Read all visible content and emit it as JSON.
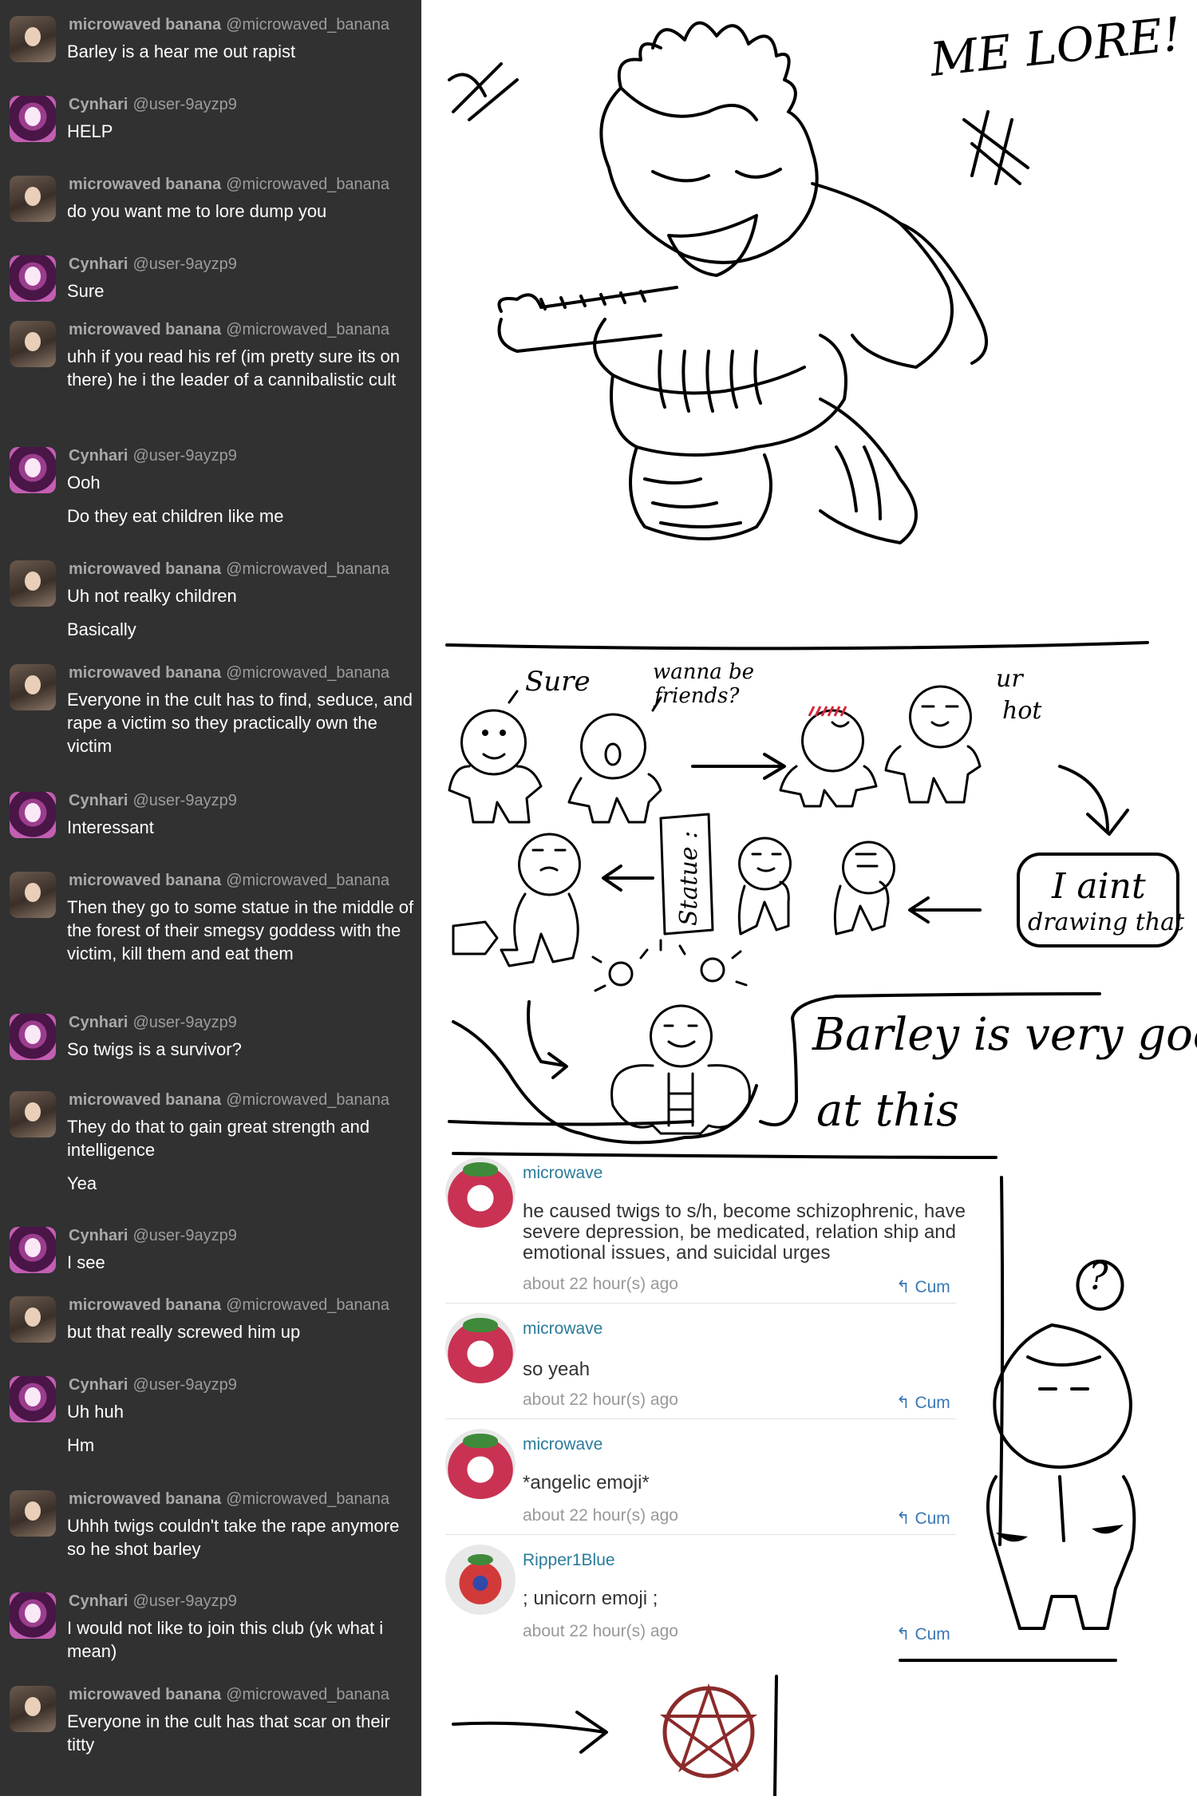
{
  "chat": {
    "messages": [
      {
        "user": "microwaved banana",
        "handle": "@microwaved_banana",
        "lines": [
          "Barley is a hear me out rapist"
        ]
      },
      {
        "user": "Cynhari",
        "handle": "@user-9ayzp9",
        "lines": [
          "HELP"
        ]
      },
      {
        "user": "microwaved banana",
        "handle": "@microwaved_banana",
        "lines": [
          "do you want me to lore dump you"
        ]
      },
      {
        "user": "Cynhari",
        "handle": "@user-9ayzp9",
        "lines": [
          "Sure"
        ]
      },
      {
        "user": "microwaved banana",
        "handle": "@microwaved_banana",
        "lines": [
          "uhh if you read his ref (im pretty sure its on there) he i the leader of a cannibalistic cult"
        ]
      },
      {
        "user": "Cynhari",
        "handle": "@user-9ayzp9",
        "lines": [
          "Ooh",
          "Do they eat children like me"
        ]
      },
      {
        "user": "microwaved banana",
        "handle": "@microwaved_banana",
        "lines": [
          "Uh not realky children",
          "Basically"
        ]
      },
      {
        "user": "microwaved banana",
        "handle": "@microwaved_banana",
        "lines": [
          "Everyone in the cult has to find, seduce, and rape a victim so they practically own the victim"
        ]
      },
      {
        "user": "Cynhari",
        "handle": "@user-9ayzp9",
        "lines": [
          "Interessant"
        ]
      },
      {
        "user": "microwaved banana",
        "handle": "@microwaved_banana",
        "lines": [
          "Then they go to some statue in the middle of the forest of their smegsy goddess with the victim, kill them and eat them"
        ]
      },
      {
        "user": "Cynhari",
        "handle": "@user-9ayzp9",
        "lines": [
          "So twigs is a survivor?"
        ]
      },
      {
        "user": "microwaved banana",
        "handle": "@microwaved_banana",
        "lines": [
          "They do that to gain great strength and intelligence",
          "Yea"
        ]
      },
      {
        "user": "Cynhari",
        "handle": "@user-9ayzp9",
        "lines": [
          "I see"
        ]
      },
      {
        "user": "microwaved banana",
        "handle": "@microwaved_banana",
        "lines": [
          "but that really screwed him up"
        ]
      },
      {
        "user": "Cynhari",
        "handle": "@user-9ayzp9",
        "lines": [
          "Uh huh",
          "Hm"
        ]
      },
      {
        "user": "microwaved banana",
        "handle": "@microwaved_banana",
        "lines": [
          "Uhhh twigs couldn't take the rape anymore so he shot barley"
        ]
      },
      {
        "user": "Cynhari",
        "handle": "@user-9ayzp9",
        "lines": [
          "I would not like to join this club (yk what i mean)"
        ]
      },
      {
        "user": "microwaved banana",
        "handle": "@microwaved_banana",
        "lines": [
          "Everyone in the cult has that scar on their titty"
        ]
      }
    ]
  },
  "drawing": {
    "title": "ME LORE!",
    "bubble_sure": "Sure",
    "bubble_friends_1": "wanna be",
    "bubble_friends_2": "friends?",
    "bubble_hot_1": "ur",
    "bubble_hot_2": "hot",
    "statue_label": "Statue :",
    "box_line_1": "I aint",
    "box_line_2": "drawing that",
    "barley_line_1": "Barley is very good",
    "barley_line_2": "at this",
    "question_mark": "?",
    "accent_pentagram": "#8b2b2b"
  },
  "comments": [
    {
      "name": "microwave",
      "text": "he caused twigs to s/h, become schizophrenic, have severe depression, be medicated, relation ship and emotional issues, and suicidal urges",
      "time": "about 22 hour(s) ago",
      "reply": "Cum",
      "avatar": "strawberry"
    },
    {
      "name": "microwave",
      "text": "so yeah",
      "time": "about 22 hour(s) ago",
      "reply": "Cum",
      "avatar": "strawberry"
    },
    {
      "name": "microwave",
      "text": "*angelic emoji*",
      "time": "about 22 hour(s) ago",
      "reply": "Cum",
      "avatar": "strawberry"
    },
    {
      "name": "Ripper1Blue",
      "text": "; unicorn emoji ;",
      "time": "about 22 hour(s) ago",
      "reply": "Cum",
      "avatar": "ripper"
    }
  ]
}
